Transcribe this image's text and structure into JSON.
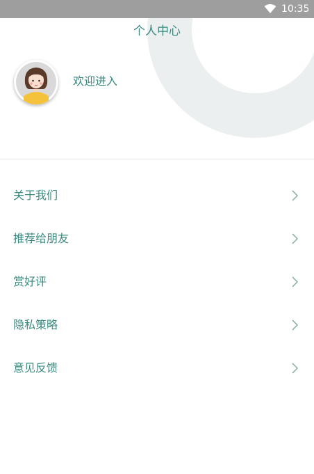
{
  "status_bar": {
    "time": "10:35",
    "icons": [
      "wifi-icon"
    ]
  },
  "header": {
    "title": "个人中心",
    "welcome": "欢迎进入",
    "avatar": "cartoon-girl-avatar"
  },
  "menu": {
    "items": [
      {
        "label": "关于我们",
        "icon": "chevron-right-icon"
      },
      {
        "label": "推荐给朋友",
        "icon": "chevron-right-icon"
      },
      {
        "label": "赏好评",
        "icon": "chevron-right-icon"
      },
      {
        "label": "隐私策略",
        "icon": "chevron-right-icon"
      },
      {
        "label": "意见反馈",
        "icon": "chevron-right-icon"
      }
    ]
  },
  "colors": {
    "accent_text": "#3a8a80",
    "status_bar": "#9e9e9e",
    "decor_ring": "#eceff0",
    "chevron": "#7aa9a3",
    "divider": "#e4e4e4"
  }
}
